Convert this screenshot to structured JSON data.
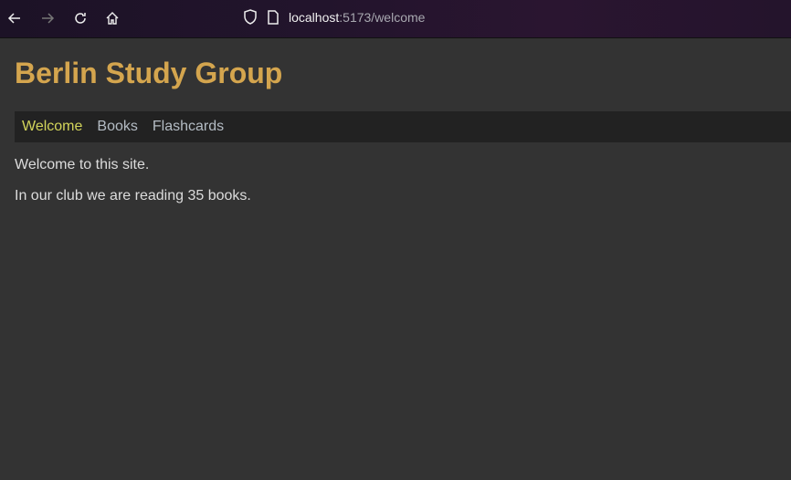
{
  "browser": {
    "url_host": "localhost",
    "url_rest": ":5173/welcome"
  },
  "site": {
    "title": "Berlin Study Group"
  },
  "nav": {
    "items": [
      {
        "label": "Welcome"
      },
      {
        "label": "Books"
      },
      {
        "label": "Flashcards"
      }
    ]
  },
  "content": {
    "line1": "Welcome to this site.",
    "line2": "In our club we are reading 35 books."
  }
}
